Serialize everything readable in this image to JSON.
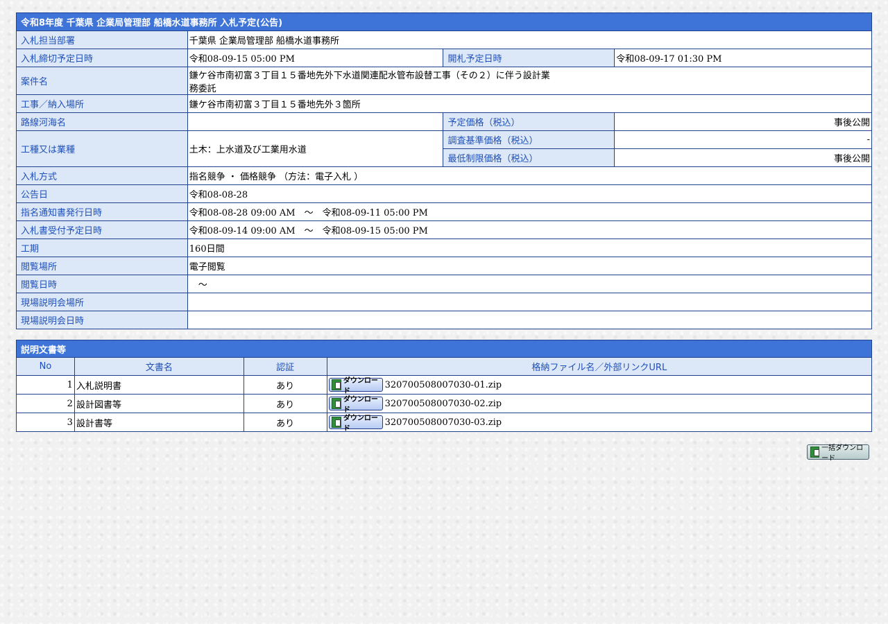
{
  "header": {
    "title": "令和8年度 千葉県 企業局管理部 船橋水道事務所 入札予定(公告)"
  },
  "fields": {
    "dept_label": "入札担当部署",
    "dept_value": "千葉県 企業局管理部 船橋水道事務所",
    "deadline_label": "入札締切予定日時",
    "deadline_value": "令和08-09-15 05:00 PM",
    "open_label": "開札予定日時",
    "open_value": "令和08-09-17 01:30 PM",
    "case_label": "案件名",
    "case_value_line1": "鎌ケ谷市南初富３丁目１５番地先外下水道関連配水管布設替工事（その２）に伴う設計業",
    "case_value_line2": "務委託",
    "place_label": "工事／納入場所",
    "place_value": "鎌ケ谷市南初富３丁目１５番地先外３箇所",
    "route_label": "路線河海名",
    "route_value": "",
    "planned_price_label": "予定価格（税込）",
    "planned_price_value": "事後公開",
    "type_label": "工種又は業種",
    "type_value": "土木：上水道及び工業用水道",
    "survey_price_label": "調査基準価格（税込）",
    "survey_price_value": "-",
    "min_price_label": "最低制限価格（税込）",
    "min_price_value": "事後公開",
    "method_label": "入札方式",
    "method_value": "指名競争 ・ 価格競争 （方法：電子入札 ）",
    "notice_label": "公告日",
    "notice_value": "令和08-08-28",
    "designation_label": "指名通知書発行日時",
    "designation_value": "令和08-08-28 09:00 AM　～　令和08-09-11 05:00 PM",
    "accept_label": "入札書受付予定日時",
    "accept_value": "令和08-09-14 09:00 AM　～　令和08-09-15 05:00 PM",
    "period_label": "工期",
    "period_value": "160日間",
    "view_place_label": "閲覧場所",
    "view_place_value": "電子閲覧",
    "view_date_label": "閲覧日時",
    "view_date_value": "　～",
    "briefing_place_label": "現場説明会場所",
    "briefing_place_value": "",
    "briefing_date_label": "現場説明会日時",
    "briefing_date_value": ""
  },
  "documents": {
    "title": "説明文書等",
    "columns": [
      "No",
      "文書名",
      "認証",
      "格納ファイル名／外部リンクURL"
    ],
    "download_label": "ダウンロード",
    "rows": [
      {
        "no": "1",
        "name": "入札説明書",
        "auth": "あり",
        "file": "320700508007030-01.zip"
      },
      {
        "no": "2",
        "name": "設計図書等",
        "auth": "あり",
        "file": "320700508007030-02.zip"
      },
      {
        "no": "3",
        "name": "設計書等",
        "auth": "あり",
        "file": "320700508007030-03.zip"
      }
    ]
  },
  "bulk_download_label": "一括ダウンロード",
  "colors": {
    "header_bg": "#3e73d7",
    "label_bg": "#dce8f7",
    "label_text": "#1f4fb8",
    "border": "#1f3f8f"
  },
  "icons": {
    "download": "download-disk-icon"
  }
}
